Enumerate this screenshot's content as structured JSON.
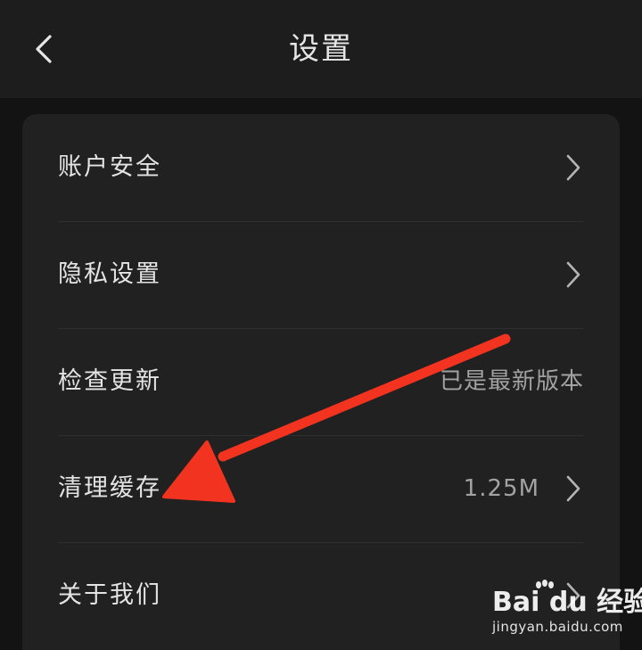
{
  "header": {
    "title": "设置",
    "back_icon": "chevron-left-icon"
  },
  "settings": {
    "items": [
      {
        "label": "账户安全",
        "value": "",
        "chevron": true
      },
      {
        "label": "隐私设置",
        "value": "",
        "chevron": true
      },
      {
        "label": "检查更新",
        "value": "已是最新版本",
        "chevron": false
      },
      {
        "label": "清理缓存",
        "value": "1.25M",
        "chevron": true
      },
      {
        "label": "关于我们",
        "value": "",
        "chevron": true
      }
    ]
  },
  "watermark": {
    "logo_text": "Bai du 经验",
    "site": "jingyan.baidu.com"
  },
  "colors": {
    "background": "#131313",
    "header": "#1d1d1d",
    "card": "#212121",
    "text_primary": "#e4e4e4",
    "text_secondary": "#a2a2a2",
    "annotation_arrow": "#f2331f"
  }
}
